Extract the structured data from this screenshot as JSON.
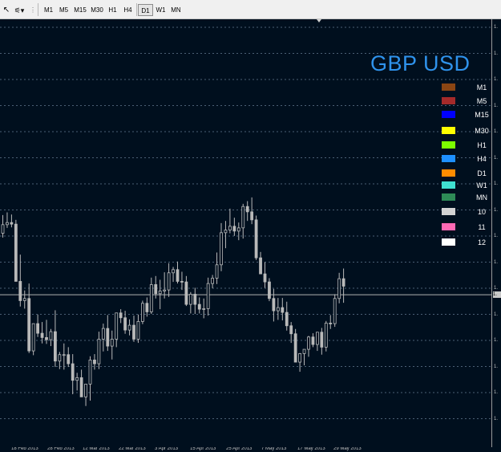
{
  "toolbar": {
    "timeframes": [
      {
        "label": "M1",
        "active": false
      },
      {
        "label": "M5",
        "active": false
      },
      {
        "label": "M15",
        "active": false
      },
      {
        "label": "M30",
        "active": false
      },
      {
        "label": "H1",
        "active": false
      },
      {
        "label": "H4",
        "active": false
      },
      {
        "label": "D1",
        "active": true
      },
      {
        "label": "W1",
        "active": false
      },
      {
        "label": "MN",
        "active": false
      }
    ]
  },
  "chart": {
    "title": "GBP USD",
    "colors": {
      "background": "#000f1e",
      "candle": "#b9b9b9",
      "grid": "#4a5f74",
      "title": "#2f93ec"
    },
    "legend": [
      {
        "label": "M1",
        "color": "#8b4513"
      },
      {
        "label": "M5",
        "color": "#a52a2a"
      },
      {
        "label": "M15",
        "color": "#0000ff"
      },
      {
        "label": "M30",
        "color": "#ffff00"
      },
      {
        "label": "H1",
        "color": "#7cfc00"
      },
      {
        "label": "H4",
        "color": "#1e90ff"
      },
      {
        "label": "D1",
        "color": "#ff8c00"
      },
      {
        "label": "W1",
        "color": "#40e0d0"
      },
      {
        "label": "MN",
        "color": "#2e8b57"
      },
      {
        "label": "10",
        "color": "#d3d3d3"
      },
      {
        "label": "11",
        "color": "#ff69b4"
      },
      {
        "label": "12",
        "color": "#ffffff"
      }
    ],
    "date_labels": [
      "18 Feb 2013",
      "28 Feb 2013",
      "12 Mar 2013",
      "22 Mar 2013",
      "3 Apr 2013",
      "15 Apr 2013",
      "25 Apr 2013",
      "7 May 2013",
      "17 May 2013",
      "29 May 2013"
    ],
    "price_labels": [
      "1.",
      "1.",
      "1.",
      "1.",
      "1.",
      "1.",
      "1.",
      "1.",
      "1.",
      "1.",
      "1.",
      "1.",
      "1.",
      "1.",
      "1.",
      "1."
    ],
    "current_price_label": "1."
  },
  "chart_data": {
    "type": "candlestick",
    "title": "GBP USD",
    "x": [
      "2013-02-13",
      "2013-02-14",
      "2013-02-15",
      "2013-02-18",
      "2013-02-19",
      "2013-02-20",
      "2013-02-21",
      "2013-02-22",
      "2013-02-25",
      "2013-02-26",
      "2013-02-27",
      "2013-02-28",
      "2013-03-01",
      "2013-03-04",
      "2013-03-05",
      "2013-03-06",
      "2013-03-07",
      "2013-03-08",
      "2013-03-11",
      "2013-03-12",
      "2013-03-13",
      "2013-03-14",
      "2013-03-15",
      "2013-03-18",
      "2013-03-19",
      "2013-03-20",
      "2013-03-21",
      "2013-03-22",
      "2013-03-25",
      "2013-03-26",
      "2013-03-27",
      "2013-03-28",
      "2013-03-29",
      "2013-04-01",
      "2013-04-02",
      "2013-04-03",
      "2013-04-04",
      "2013-04-05",
      "2013-04-08",
      "2013-04-09",
      "2013-04-10",
      "2013-04-11",
      "2013-04-12",
      "2013-04-15",
      "2013-04-16",
      "2013-04-17",
      "2013-04-18",
      "2013-04-19",
      "2013-04-22",
      "2013-04-23",
      "2013-04-24",
      "2013-04-25",
      "2013-04-26",
      "2013-04-29",
      "2013-04-30",
      "2013-05-01",
      "2013-05-02",
      "2013-05-03",
      "2013-05-06",
      "2013-05-07",
      "2013-05-08",
      "2013-05-09",
      "2013-05-10",
      "2013-05-13",
      "2013-05-14",
      "2013-05-15",
      "2013-05-16",
      "2013-05-17",
      "2013-05-20",
      "2013-05-21",
      "2013-05-22",
      "2013-05-23",
      "2013-05-24",
      "2013-05-27",
      "2013-05-28",
      "2013-05-29",
      "2013-05-30",
      "2013-05-31",
      "2013-06-03"
    ],
    "series": [
      {
        "open": [
          70.0,
          71.6,
          72.0,
          71.7,
          61.0,
          57.4,
          57.8,
          48.0,
          53.1,
          51.3,
          50.5,
          50.1,
          51.6,
          46.1,
          47.3,
          47.3,
          45.6,
          42.5,
          43.0,
          39.4,
          41.8,
          46.3,
          45.6,
          50.2,
          52.2,
          48.9,
          50.2,
          55.1,
          54.2,
          51.9,
          52.8,
          50.2,
          53.5,
          56.9,
          55.3,
          60.4,
          58.7,
          59.2,
          59.4,
          62.6,
          63.2,
          61.0,
          60.9,
          56.7,
          58.6,
          56.7,
          55.8,
          55.9,
          60.6,
          61.6,
          64.1,
          70.1,
          70.6,
          71.3,
          70.4,
          71.0,
          75.0,
          74.0,
          72.5,
          65.4,
          62.4,
          60.9,
          57.8,
          55.5,
          56.1,
          55.2,
          52.7,
          51.2,
          45.9,
          47.5,
          48.3,
          50.6,
          49.2,
          51.5,
          48.7,
          53.2,
          53.1,
          57.8,
          61.5
        ],
        "high": [
          73.4,
          73.9,
          73.5,
          72.5,
          66.0,
          59.3,
          60.6,
          52.2,
          54.8,
          53.4,
          53.8,
          52.1,
          55.6,
          47.8,
          49.4,
          48.7,
          47.4,
          43.9,
          44.5,
          41.2,
          47.0,
          47.4,
          51.6,
          53.1,
          54.7,
          51.8,
          55.1,
          55.8,
          55.5,
          53.9,
          54.6,
          54.8,
          57.4,
          58.0,
          61.7,
          62.0,
          61.3,
          62.7,
          64.4,
          63.7,
          64.7,
          62.8,
          62.0,
          59.0,
          59.8,
          58.0,
          57.8,
          61.7,
          62.2,
          66.4,
          71.9,
          72.3,
          74.6,
          72.9,
          72.0,
          75.5,
          76.0,
          76.7,
          73.3,
          66.5,
          64.6,
          61.6,
          59.6,
          57.9,
          57.9,
          57.2,
          53.4,
          52.1,
          47.6,
          48.2,
          50.8,
          51.3,
          51.3,
          52.3,
          53.6,
          54.7,
          58.6,
          62.6,
          63.4
        ],
        "low": [
          69.2,
          71.0,
          71.1,
          61.0,
          56.3,
          55.9,
          47.6,
          47.2,
          50.6,
          49.4,
          49.3,
          48.9,
          45.0,
          44.6,
          44.5,
          45.0,
          39.9,
          40.6,
          39.4,
          37.7,
          38.7,
          44.5,
          44.6,
          47.9,
          48.0,
          46.4,
          48.7,
          53.2,
          51.2,
          50.9,
          49.7,
          49.5,
          53.0,
          54.4,
          54.9,
          57.8,
          55.8,
          57.8,
          58.1,
          60.9,
          60.6,
          59.4,
          56.4,
          55.0,
          54.9,
          55.0,
          54.1,
          54.6,
          59.7,
          60.5,
          62.9,
          67.2,
          70.0,
          69.5,
          68.7,
          69.0,
          72.3,
          71.7,
          65.0,
          62.5,
          59.8,
          57.3,
          53.5,
          53.8,
          53.7,
          51.8,
          49.5,
          45.9,
          44.1,
          45.3,
          46.9,
          48.7,
          48.0,
          47.3,
          47.9,
          52.1,
          52.5,
          56.9,
          57.0
        ],
        "close": [
          71.6,
          72.0,
          71.7,
          61.0,
          57.4,
          57.8,
          48.0,
          53.1,
          51.3,
          50.5,
          50.1,
          51.6,
          46.1,
          47.3,
          47.3,
          45.6,
          42.5,
          43.0,
          39.4,
          41.8,
          46.3,
          45.6,
          50.2,
          52.2,
          48.9,
          50.2,
          55.1,
          54.2,
          51.9,
          52.8,
          50.2,
          53.5,
          56.9,
          55.3,
          60.4,
          58.7,
          59.2,
          59.4,
          62.6,
          63.2,
          61.0,
          60.9,
          56.7,
          58.6,
          56.7,
          55.8,
          55.9,
          60.6,
          61.6,
          64.1,
          70.1,
          70.6,
          71.3,
          70.4,
          71.0,
          75.0,
          74.0,
          72.5,
          65.4,
          62.4,
          60.9,
          57.8,
          55.5,
          56.1,
          55.2,
          52.7,
          51.2,
          45.9,
          47.5,
          48.3,
          50.6,
          49.2,
          51.5,
          48.7,
          53.2,
          53.1,
          57.8,
          61.5,
          60.1
        ]
      }
    ],
    "current_price": 58.5,
    "ylim": [
      30,
      110
    ],
    "grid": true,
    "legend_position": "right",
    "legend": [
      "M1",
      "M5",
      "M15",
      "M30",
      "H1",
      "H4",
      "D1",
      "W1",
      "MN",
      "10",
      "11",
      "12"
    ],
    "x_tick_labels": [
      "18 Feb 2013",
      "28 Feb 2013",
      "12 Mar 2013",
      "22 Mar 2013",
      "3 Apr 2013",
      "15 Apr 2013",
      "25 Apr 2013",
      "7 May 2013",
      "17 May 2013",
      "29 May 2013"
    ],
    "y_tick_labels": [
      "1.",
      "1.",
      "1.",
      "1.",
      "1.",
      "1.",
      "1.",
      "1.",
      "1.",
      "1.",
      "1.",
      "1.",
      "1.",
      "1.",
      "1.",
      "1."
    ]
  }
}
